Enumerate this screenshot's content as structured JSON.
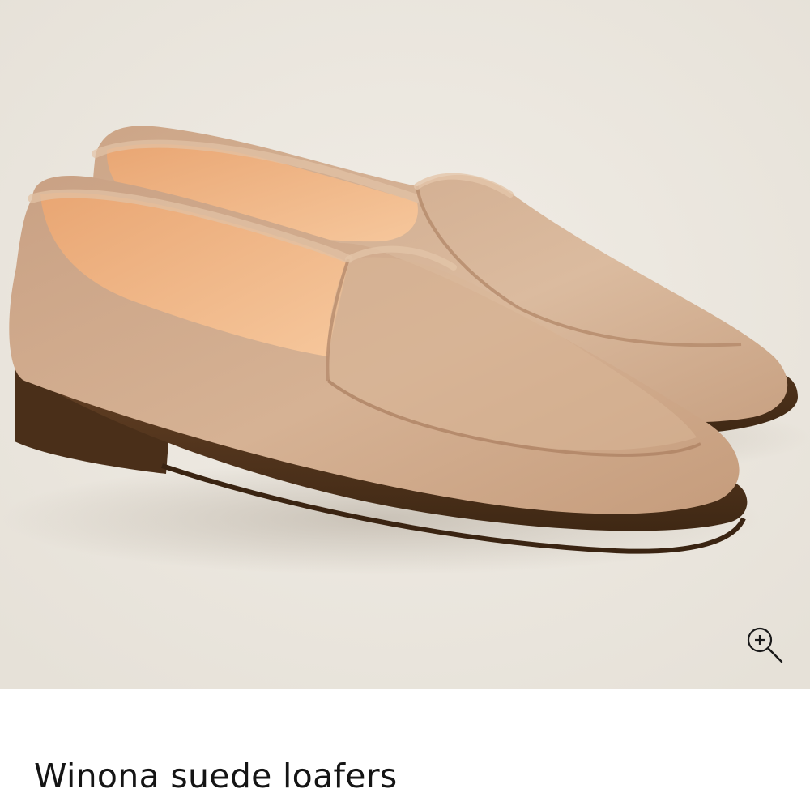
{
  "product": {
    "title": "Winona suede loafers"
  },
  "image": {
    "subject": "tan suede loafers pair",
    "zoom_icon": "zoom-in-icon"
  },
  "colors": {
    "backdrop": "#eeeae3",
    "suede": "#d2ab8c",
    "suede_shadow": "#b88f70",
    "lining": "#f1b888",
    "sole": "#5c3c22",
    "title_text": "#141414"
  }
}
